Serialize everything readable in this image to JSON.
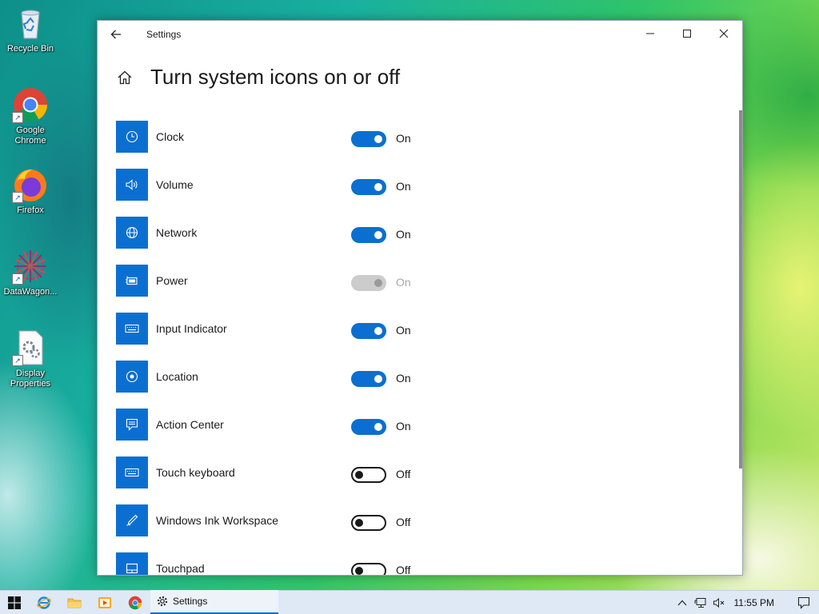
{
  "desktop": {
    "icons": [
      {
        "label": "Recycle Bin"
      },
      {
        "label": "Google Chrome"
      },
      {
        "label": "Firefox"
      },
      {
        "label": "DataWagon..."
      },
      {
        "label": "Display Properties"
      }
    ]
  },
  "window": {
    "title": "Settings",
    "heading": "Turn system icons on or off"
  },
  "settings": [
    {
      "name": "Clock",
      "icon": "clock-icon",
      "state": "On"
    },
    {
      "name": "Volume",
      "icon": "volume-icon",
      "state": "On"
    },
    {
      "name": "Network",
      "icon": "globe-icon",
      "state": "On"
    },
    {
      "name": "Power",
      "icon": "battery-icon",
      "state": "On"
    },
    {
      "name": "Input Indicator",
      "icon": "keyboard-icon",
      "state": "On"
    },
    {
      "name": "Location",
      "icon": "location-icon",
      "state": "On"
    },
    {
      "name": "Action Center",
      "icon": "action-center-icon",
      "state": "On"
    },
    {
      "name": "Touch keyboard",
      "icon": "keyboard-icon",
      "state": "Off"
    },
    {
      "name": "Windows Ink Workspace",
      "icon": "pen-icon",
      "state": "Off"
    },
    {
      "name": "Touchpad",
      "icon": "touchpad-icon",
      "state": "Off"
    }
  ],
  "taskbar": {
    "active_app": "Settings",
    "clock": "11:55 PM"
  },
  "colors": {
    "accent": "#0b6fd1",
    "toggle_disabled": "#cccccc"
  }
}
